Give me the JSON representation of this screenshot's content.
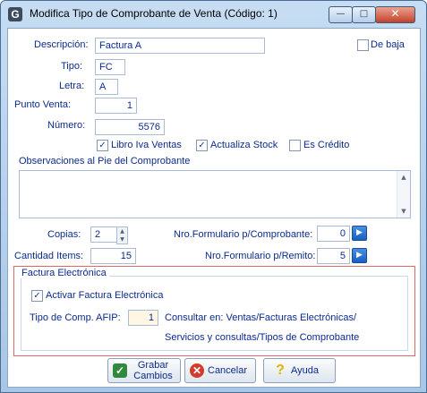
{
  "window": {
    "title": "Modifica Tipo de Comprobante de Venta  (Código: 1)",
    "app_icon": "G",
    "minimize": "—",
    "maximize": "□",
    "close": "✕"
  },
  "form": {
    "descripcion_label": "Descripción:",
    "descripcion_value": "Factura A",
    "de_baja_label": "De baja",
    "de_baja_checked": false,
    "tipo_label": "Tipo:",
    "tipo_value": "FC",
    "letra_label": "Letra:",
    "letra_value": "A",
    "punto_venta_label": "Punto Venta:",
    "punto_venta_value": "1",
    "numero_label": "Número:",
    "numero_value": "5576",
    "libro_iva_label": "Libro Iva Ventas",
    "libro_iva_checked": true,
    "actualiza_stock_label": "Actualiza Stock",
    "actualiza_stock_checked": true,
    "es_credito_label": "Es Crédito",
    "es_credito_checked": false,
    "observaciones_label": "Observaciones al Pie del Comprobante",
    "observaciones_value": "",
    "copias_label": "Copias:",
    "copias_value": "2",
    "cantidad_items_label": "Cantidad Items:",
    "cantidad_items_value": "15",
    "nro_formulario_comprobante_label": "Nro.Formulario p/Comprobante:",
    "nro_formulario_comprobante_value": "0",
    "nro_formulario_remito_label": "Nro.Formulario p/Remito:",
    "nro_formulario_remito_value": "5"
  },
  "factura_electronica": {
    "legend": "Factura Electrónica",
    "activar_label": "Activar Factura Electrónica",
    "activar_checked": true,
    "tipo_comp_label": "Tipo de Comp. AFIP:",
    "tipo_comp_value": "1",
    "consultar_line1": "Consultar en: Ventas/Facturas Electrónicas/",
    "consultar_line2": "Servicios y consultas/Tipos de Comprobante"
  },
  "buttons": {
    "grabar_line1": "Grabar",
    "grabar_line2": "Cambios",
    "cancelar": "Cancelar",
    "ayuda": "Ayuda"
  },
  "colors": {
    "label_text": "#0b2a8f",
    "fieldset_border": "#d86a6a",
    "titlebar": "#b7d1ec",
    "close_button": "#c3412a"
  },
  "icons": {
    "app": "app-icon",
    "nav_next": "arrow-right-icon",
    "save": "checkmark-icon",
    "cancel": "cancel-icon",
    "help": "question-icon"
  }
}
